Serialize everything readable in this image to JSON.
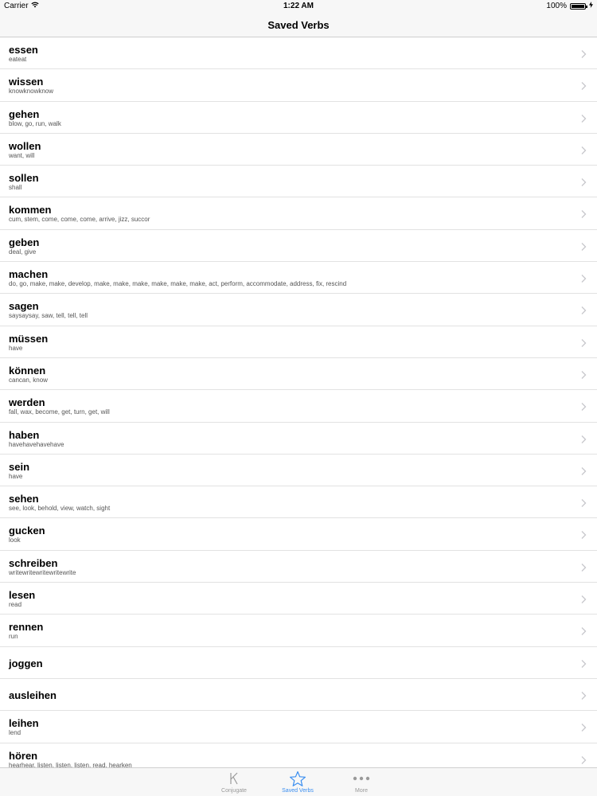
{
  "status_bar": {
    "carrier": "Carrier",
    "time": "1:22 AM",
    "battery": "100%",
    "battery_level": 1.0
  },
  "nav": {
    "title": "Saved Verbs"
  },
  "verbs": [
    {
      "word": "essen",
      "meaning": "eateat"
    },
    {
      "word": "wissen",
      "meaning": "knowknowknow"
    },
    {
      "word": "gehen",
      "meaning": "blow, go, run, walk"
    },
    {
      "word": "wollen",
      "meaning": "want, will"
    },
    {
      "word": "sollen",
      "meaning": "shall"
    },
    {
      "word": "kommen",
      "meaning": "cum, stem, come, come, come, arrive, jizz, succor"
    },
    {
      "word": "geben",
      "meaning": "deal, give"
    },
    {
      "word": "machen",
      "meaning": "do, go, make, make, develop, make, make, make, make, make, make, act, perform, accommodate, address, fix, rescind"
    },
    {
      "word": "sagen",
      "meaning": "saysaysay, saw, tell, tell, tell"
    },
    {
      "word": "müssen",
      "meaning": "have"
    },
    {
      "word": "können",
      "meaning": "cancan, know"
    },
    {
      "word": "werden",
      "meaning": "fall, wax, become, get, turn, get, will"
    },
    {
      "word": "haben",
      "meaning": "havehavehavehave"
    },
    {
      "word": "sein",
      "meaning": "have"
    },
    {
      "word": "sehen",
      "meaning": "see, look, behold, view, watch, sight"
    },
    {
      "word": "gucken",
      "meaning": "look"
    },
    {
      "word": "schreiben",
      "meaning": "writewritewritewritewrite"
    },
    {
      "word": "lesen",
      "meaning": "read"
    },
    {
      "word": "rennen",
      "meaning": "run"
    },
    {
      "word": "joggen",
      "meaning": ""
    },
    {
      "word": "ausleihen",
      "meaning": ""
    },
    {
      "word": "leihen",
      "meaning": "lend"
    },
    {
      "word": "hören",
      "meaning": "hearhear, listen, listen, listen, read, hearken"
    }
  ],
  "tab_bar": {
    "tabs": [
      {
        "label": "Conjugate",
        "icon": "k-icon",
        "active": false
      },
      {
        "label": "Saved Verbs",
        "icon": "star-icon",
        "active": true
      },
      {
        "label": "More",
        "icon": "more-icon",
        "active": false
      }
    ]
  },
  "colors": {
    "accent": "#3a8ef0",
    "inactive": "#999999",
    "bar_background": "#f7f7f7"
  }
}
